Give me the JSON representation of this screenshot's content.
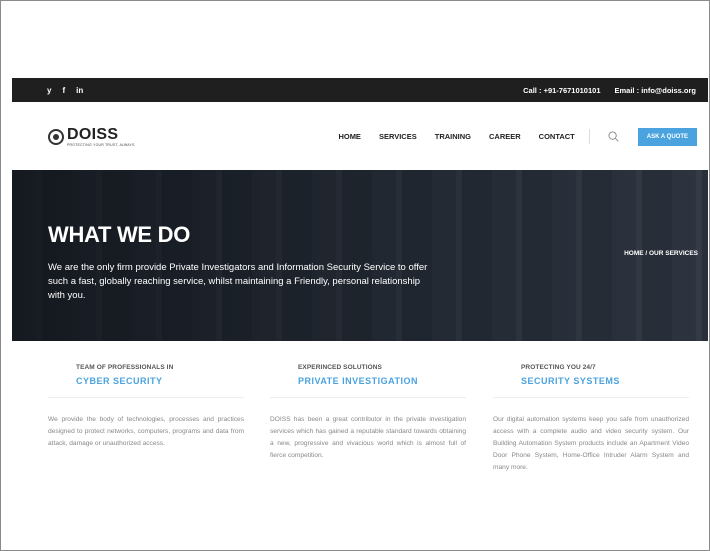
{
  "topbar": {
    "social": [
      "y",
      "f",
      "in"
    ],
    "phone_label": "Call :",
    "phone": "+91-7671010101",
    "email_label": "Email :",
    "email": "info@doiss.org"
  },
  "header": {
    "logo": "DOISS",
    "logo_tagline": "PROTECTING YOUR TRUST, ALWAYS",
    "nav": [
      "HOME",
      "SERVICES",
      "TRAINING",
      "CAREER",
      "CONTACT"
    ],
    "quote_button": "ASK A QUOTE"
  },
  "hero": {
    "title": "WHAT WE DO",
    "text": "We are the only firm provide Private Investigators and Information Security Service to offer such a fast, globally reaching service, whilst maintaining a Friendly, personal relationship with you.",
    "breadcrumb": "HOME  /  OUR SERVICES"
  },
  "services": [
    {
      "eyebrow": "TEAM OF PROFESSIONALS IN",
      "heading": "CYBER SECURITY",
      "body": "We provide the body of technologies, processes and practices designed to protect networks, computers, programs and data from attack, damage or unauthorized access."
    },
    {
      "eyebrow": "EXPERINCED SOLUTIONS",
      "heading": "PRIVATE INVESTIGATION",
      "body": "DOISS has been a great contributor in the private investigation services which has gained a reputable standard towards obtaining a new, progressive and vivacious world which is almost full of fierce competition."
    },
    {
      "eyebrow": "PROTECTING YOU 24/7",
      "heading": "SECURITY SYSTEMS",
      "body": "Our digital automation systems keep you safe from unauthorized access with a complete audio and video security system. Our Building Automation System products include an Apartment Video Door Phone System, Home-Office Intruder Alarm System and many more."
    }
  ],
  "colors": {
    "accent": "#4aa3df",
    "topbar": "#1f1f1f"
  }
}
